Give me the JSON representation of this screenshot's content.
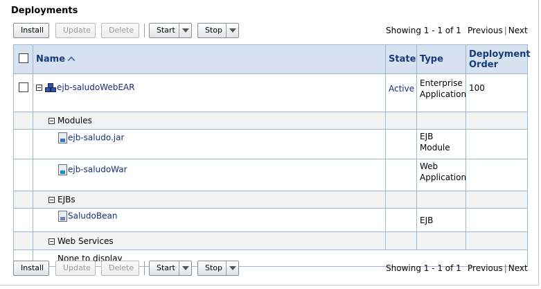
{
  "panel": {
    "title": "Deployments"
  },
  "toolbar": {
    "install": "Install",
    "update": "Update",
    "delete": "Delete",
    "start": "Start",
    "stop": "Stop",
    "showing": "Showing 1 - 1 of 1",
    "previous": "Previous",
    "separator": "|",
    "next": "Next"
  },
  "table": {
    "headers": {
      "name": "Name",
      "state": "State",
      "type": "Type",
      "order": "Deployment Order"
    },
    "app": {
      "name": "ejb-saludoWebEAR",
      "state": "Active",
      "type": "Enterprise Application",
      "order": "100"
    },
    "modules_label": "Modules",
    "modules": [
      {
        "name": "ejb-saludo.jar",
        "type": "EJB Module"
      },
      {
        "name": "ejb-saludoWar",
        "type": "Web Application"
      }
    ],
    "ejbs_label": "EJBs",
    "ejbs": [
      {
        "name": "SaludoBean",
        "type": "EJB"
      }
    ],
    "ws_label": "Web Services",
    "ws_none": "None to display"
  }
}
